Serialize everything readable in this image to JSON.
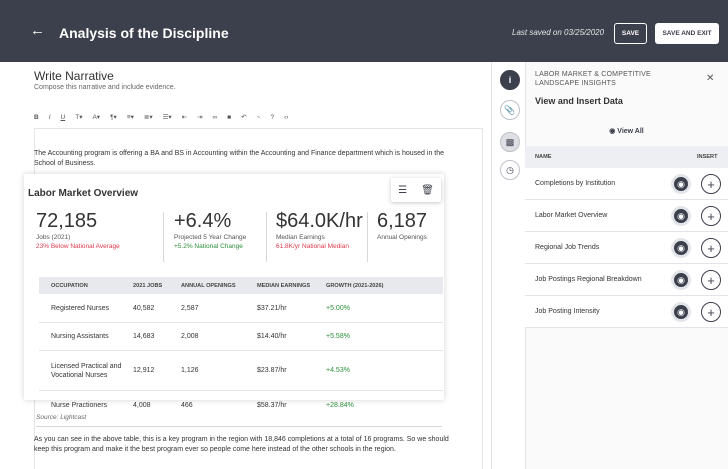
{
  "header": {
    "title": "Analysis of the Discipline",
    "saved_text": "Last saved on 03/25/2020",
    "save_label": "SAVE",
    "save_exit_label": "SAVE AND EXIT"
  },
  "editor": {
    "title": "Write Narrative",
    "subtitle": "Compose this narrative and include evidence.",
    "toolbar": [
      "B",
      "I",
      "U",
      "T▾",
      "A▾",
      "¶▾",
      "≡▾",
      "≣▾",
      "☰▾",
      "⇤",
      "⇥",
      "∞",
      "■",
      "↶",
      "~",
      "?",
      "‹›"
    ],
    "intro": "The Accounting program is offering a BA and BS in Accounting within the Accounting and Finance department which is housed in the School of Business.",
    "card": {
      "title": "Labor Market Overview",
      "stats": [
        {
          "value": "72,185",
          "label": "Jobs (2021)",
          "change": "23% Below National Average",
          "tone": "red"
        },
        {
          "value": "+6.4%",
          "label": "Projected 5 Year Change",
          "change": "+5.2% National Change",
          "tone": "green"
        },
        {
          "value": "$64.0K/hr",
          "label": "Median Earnings",
          "change": "61.8K/yr National Median",
          "tone": "red"
        },
        {
          "value": "6,187",
          "label": "Annual Openings",
          "change": "",
          "tone": ""
        }
      ],
      "table": {
        "headers": [
          "OCCUPATION",
          "2021 JOBS",
          "ANNUAL OPENINGS",
          "MEDIAN EARNINGS",
          "GROWTH (2021-2026)"
        ],
        "rows": [
          [
            "Registered Nurses",
            "40,582",
            "2,587",
            "$37.21/hr",
            "+5.00%"
          ],
          [
            "Nursing Assistants",
            "14,683",
            "2,008",
            "$14.40/hr",
            "+5.58%"
          ],
          [
            "Licensed Practical and Vocational Nurses",
            "12,912",
            "1,126",
            "$23.87/hr",
            "+4.53%"
          ],
          [
            "Nurse Practioners",
            "4,008",
            "466",
            "$58.37/hr",
            "+28.84%"
          ]
        ]
      }
    },
    "source": "Source: Lightcast",
    "closing": "As you can see in the above table, this is a key program in the region with 18,846 completions at a total of 16 programs. So we should keep this program and make it the best program ever so people come here instead of the other schools in the region."
  },
  "panel": {
    "kicker": "LABOR MARKET & COMPETITIVE LANDSCAPE INSIGHTS",
    "title": "View and Insert Data",
    "view_all": "View All",
    "col_name": "NAME",
    "col_insert": "INSERT",
    "items": [
      "Completions by Institution",
      "Labor Market Overview",
      "Regional Job Trends",
      "Job Postings Regional Breakdown",
      "Job Posting Intensity"
    ]
  },
  "colors": {
    "header_bg": "#3c3f4c",
    "accent": "#3c3f4c",
    "negative": "#d9394c",
    "positive": "#2a8f3a"
  }
}
